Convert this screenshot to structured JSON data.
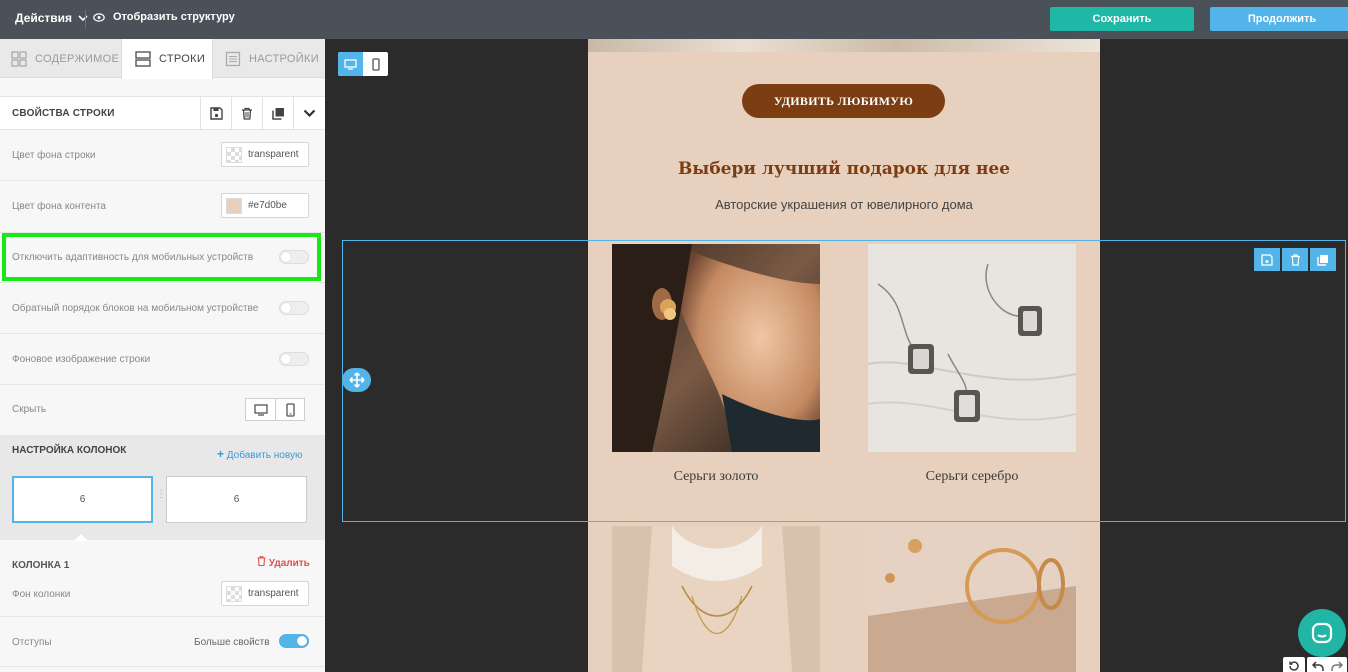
{
  "topbar": {
    "actions_label": "Действия",
    "structure_label": "Отобразить структуру",
    "save_label": "Сохранить",
    "continue_label": "Продолжить"
  },
  "tabs": [
    {
      "label": "СОДЕРЖИМОЕ",
      "icon": "grid-icon",
      "active": false
    },
    {
      "label": "СТРОКИ",
      "icon": "rows-icon",
      "active": true
    },
    {
      "label": "НАСТРОЙКИ",
      "icon": "settings-doc-icon",
      "active": false
    }
  ],
  "row_props": {
    "title": "СВОЙСТВА СТРОКИ",
    "row_bg_label": "Цвет фона строки",
    "row_bg_value": "transparent",
    "content_bg_label": "Цвет фона контента",
    "content_bg_value": "#e7d0be",
    "disable_mobile_label": "Отключить адаптивность для мобильных устройств",
    "reverse_order_label": "Обратный порядок блоков на мобильном устройстве",
    "bg_image_label": "Фоновое изображение строки",
    "hide_label": "Скрыть"
  },
  "columns": {
    "title": "НАСТРОЙКА КОЛОНОК",
    "add_new_label": "Добавить новую",
    "col_sizes": [
      "6",
      "6"
    ]
  },
  "column1": {
    "title": "КОЛОНКА 1",
    "delete_label": "Удалить",
    "bg_label": "Фон колонки",
    "bg_value": "transparent",
    "padding_label": "Отступы",
    "more_props_label": "Больше свойств"
  },
  "email": {
    "cta_label": "УДИВИТЬ ЛЮБИМУЮ",
    "headline": "Выбери лучший подарок для нее",
    "subline": "Авторские украшения от ювелирного дома",
    "products": [
      {
        "name": "Серьги золото"
      },
      {
        "name": "Серьги серебро"
      }
    ],
    "bg_color": "#e7d0be",
    "accent_color": "#7c3d12"
  },
  "colors": {
    "save": "#1fb8a6",
    "continue": "#52b4e8",
    "highlight": "#17e817"
  }
}
